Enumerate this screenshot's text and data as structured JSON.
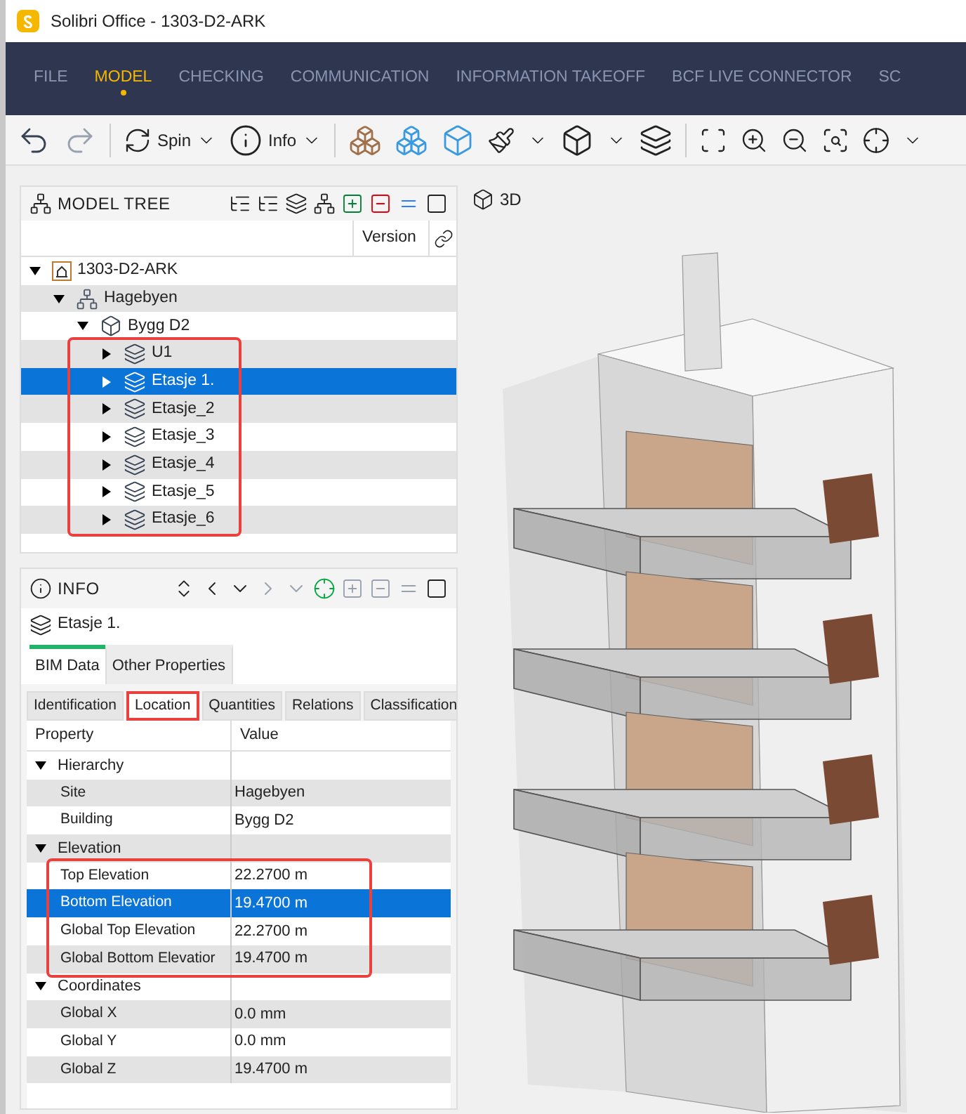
{
  "window": {
    "title": "Solibri Office - 1303-D2-ARK"
  },
  "menu_tabs": [
    {
      "label": "FILE",
      "selected": false
    },
    {
      "label": "MODEL",
      "selected": true
    },
    {
      "label": "CHECKING",
      "selected": false
    },
    {
      "label": "COMMUNICATION",
      "selected": false
    },
    {
      "label": "INFORMATION TAKEOFF",
      "selected": false
    },
    {
      "label": "BCF LIVE CONNECTOR",
      "selected": false
    },
    {
      "label": "SC",
      "selected": false
    }
  ],
  "toolbar": {
    "spin_label": "Spin",
    "info_label": "Info"
  },
  "model_tree": {
    "title": "MODEL TREE",
    "columns": [
      "Version"
    ],
    "items": [
      {
        "label": "1303-D2-ARK",
        "kind": "model",
        "expanded": true,
        "selected": false,
        "children_highlighted": false,
        "children": [
          {
            "label": "Hagebyen",
            "kind": "site",
            "expanded": true,
            "selected": false,
            "children_highlighted": false,
            "children": [
              {
                "label": "Bygg D2",
                "kind": "building",
                "expanded": true,
                "selected": false,
                "children_highlighted": true,
                "children": [
                  {
                    "label": "U1",
                    "kind": "storey",
                    "expanded": false,
                    "selected": false
                  },
                  {
                    "label": "Etasje 1.",
                    "kind": "storey",
                    "expanded": false,
                    "selected": true
                  },
                  {
                    "label": "Etasje_2",
                    "kind": "storey",
                    "expanded": false,
                    "selected": false
                  },
                  {
                    "label": "Etasje_3",
                    "kind": "storey",
                    "expanded": false,
                    "selected": false
                  },
                  {
                    "label": "Etasje_4",
                    "kind": "storey",
                    "expanded": false,
                    "selected": false
                  },
                  {
                    "label": "Etasje_5",
                    "kind": "storey",
                    "expanded": false,
                    "selected": false
                  },
                  {
                    "label": "Etasje_6",
                    "kind": "storey",
                    "expanded": false,
                    "selected": false
                  }
                ]
              }
            ]
          }
        ]
      }
    ]
  },
  "info": {
    "title": "INFO",
    "selected_object": "Etasje 1.",
    "tabs": [
      {
        "label": "BIM Data",
        "selected": true
      },
      {
        "label": "Other Properties",
        "selected": false
      }
    ],
    "subtabs": [
      {
        "label": "Identification",
        "selected": false,
        "highlighted": false
      },
      {
        "label": "Location",
        "selected": true,
        "highlighted": true
      },
      {
        "label": "Quantities",
        "selected": false,
        "highlighted": false
      },
      {
        "label": "Relations",
        "selected": false,
        "highlighted": false
      },
      {
        "label": "Classification",
        "selected": false,
        "highlighted": false
      }
    ],
    "columns": [
      "Property",
      "Value"
    ],
    "groups": [
      {
        "label": "Hierarchy",
        "expanded": true,
        "highlighted": false,
        "rows": [
          {
            "property": "Site",
            "value": "Hagebyen",
            "selected": false
          },
          {
            "property": "Building",
            "value": "Bygg D2",
            "selected": false
          }
        ]
      },
      {
        "label": "Elevation",
        "expanded": true,
        "highlighted": true,
        "rows": [
          {
            "property": "Top Elevation",
            "value": "22.2700 m",
            "selected": false
          },
          {
            "property": "Bottom Elevation",
            "value": "19.4700 m",
            "selected": true
          },
          {
            "property": "Global Top Elevation",
            "value": "22.2700 m",
            "selected": false
          },
          {
            "property": "Global Bottom Elevatior",
            "value": "19.4700 m",
            "selected": false
          }
        ]
      },
      {
        "label": "Coordinates",
        "expanded": true,
        "highlighted": false,
        "rows": [
          {
            "property": "Global X",
            "value": "0.0 mm",
            "selected": false
          },
          {
            "property": "Global Y",
            "value": "0.0 mm",
            "selected": false
          },
          {
            "property": "Global Z",
            "value": "19.4700 m",
            "selected": false
          }
        ]
      }
    ]
  },
  "viewport": {
    "label": "3D"
  }
}
